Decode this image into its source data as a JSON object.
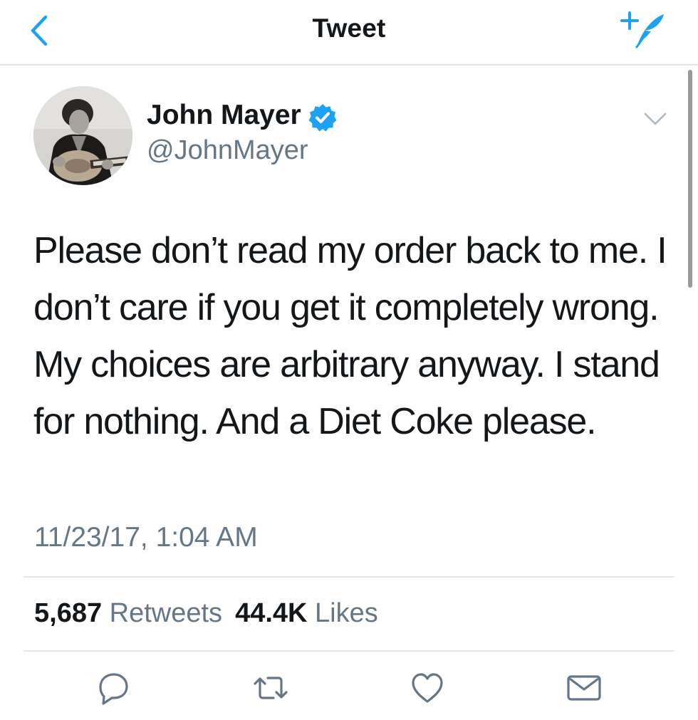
{
  "navbar": {
    "title": "Tweet",
    "back_icon": "chevron-left-icon",
    "compose_icon": "compose-tweet-icon",
    "accent_color": "#1da1f2"
  },
  "tweet": {
    "author_name": "John Mayer",
    "handle": "@JohnMayer",
    "verified": true,
    "text": "Please don’t read my order back to me. I don’t care if you get it completely wrong. My choices are arbitrary anyway. I stand for nothing. And a Diet Coke please.",
    "timestamp": "11/23/17, 1:04 AM"
  },
  "stats": {
    "retweets_count": "5,687",
    "retweets_label": "Retweets",
    "likes_count": "44.4K",
    "likes_label": "Likes"
  },
  "actions": [
    "reply-icon",
    "retweet-icon",
    "like-icon",
    "share-mail-icon"
  ],
  "colors": {
    "primary_text": "#14171a",
    "secondary_text": "#657786",
    "divider": "#e1e8ed",
    "verified_blue": "#1da1f2"
  }
}
